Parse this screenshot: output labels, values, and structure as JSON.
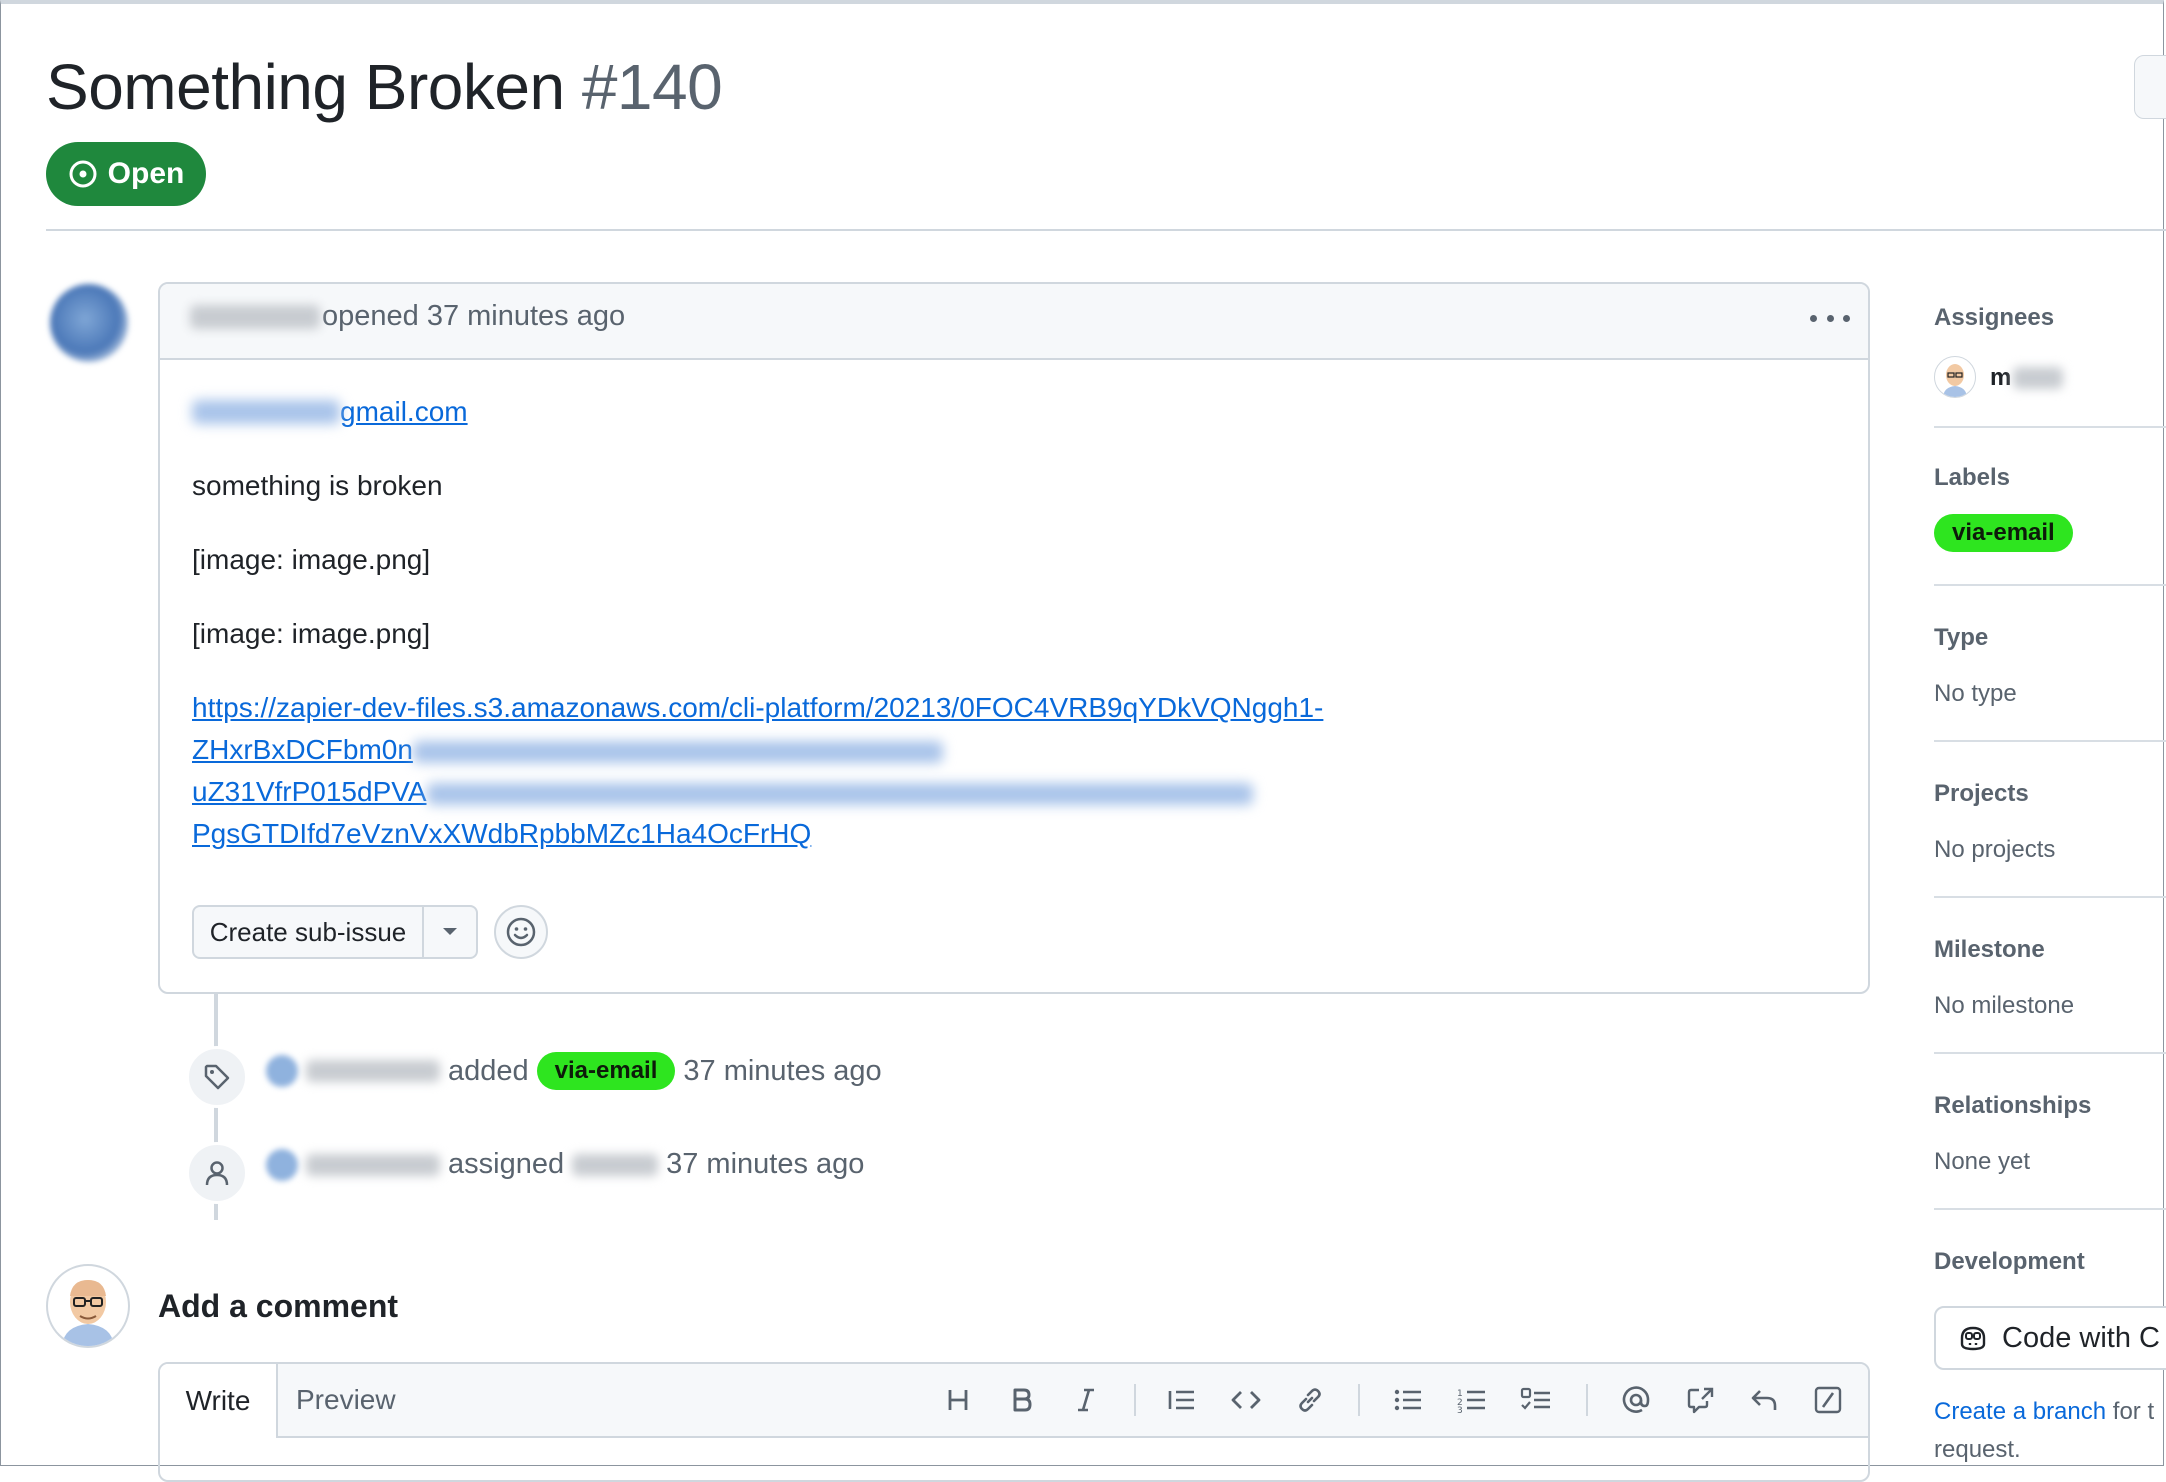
{
  "issue": {
    "title": "Something Broken",
    "number": "#140",
    "state_label": "Open"
  },
  "comment": {
    "action": "opened 37 minutes ago",
    "email_visible": "gmail.com",
    "lines": [
      "something is broken",
      "[image: image.png]",
      "[image: image.png]"
    ],
    "url_line1": "https://zapier-dev-files.s3.amazonaws.com/cli-platform/20213/0FOC4VRB9qYDkVQNggh1-",
    "url_line2": "ZHxrBxDCFbm0n",
    "url_line3": "uZ31VfrP015dPVA",
    "url_line4": "PgsGTDIfd7eVznVxXWdbRpbbMZc1Ha4OcFrHQ",
    "create_subissue": "Create sub-issue"
  },
  "timeline": [
    {
      "action": "added",
      "label": "via-email",
      "time": "37 minutes ago"
    },
    {
      "action": "assigned",
      "time": "37 minutes ago"
    }
  ],
  "composer": {
    "heading": "Add a comment",
    "tab_write": "Write",
    "tab_preview": "Preview"
  },
  "sidebar": {
    "assignees_heading": "Assignees",
    "assignee_initial": "m",
    "labels_heading": "Labels",
    "label": "via-email",
    "type_heading": "Type",
    "type_value": "No type",
    "projects_heading": "Projects",
    "projects_value": "No projects",
    "milestone_heading": "Milestone",
    "milestone_value": "No milestone",
    "relationships_heading": "Relationships",
    "relationships_value": "None yet",
    "development_heading": "Development",
    "code_with": "Code with C",
    "create_branch_link": "Create a branch",
    "create_branch_rest": " for t",
    "create_branch_line2": "request."
  },
  "colors": {
    "open_green": "#1f883d",
    "label_green": "#2ee51f",
    "link_blue": "#0969da"
  }
}
